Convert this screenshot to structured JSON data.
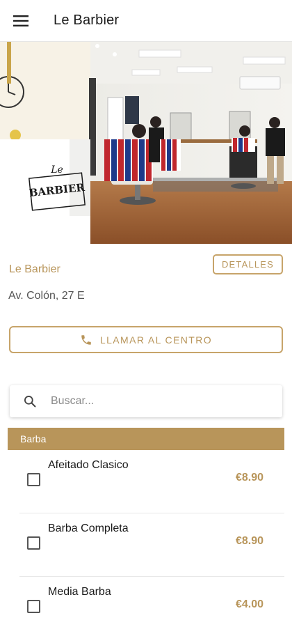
{
  "appbar": {
    "title": "Le Barbier",
    "menu_icon": "hamburger-menu-icon"
  },
  "hero": {
    "sign_top": "Le",
    "sign_main": "BARBIER"
  },
  "shop": {
    "name": "Le Barbier",
    "details_label": "DETALLES",
    "address": "Av. Colón, 27 E",
    "call_label": "LLAMAR AL CENTRO"
  },
  "search": {
    "placeholder": "Buscar...",
    "value": ""
  },
  "category": {
    "title": "Barba",
    "services": [
      {
        "name": "Afeitado Clasico",
        "price": "€8.90",
        "checked": false
      },
      {
        "name": "Barba Completa",
        "price": "€8.90",
        "checked": false
      },
      {
        "name": "Media Barba",
        "price": "€4.00",
        "checked": false
      }
    ]
  },
  "colors": {
    "accent": "#b8955a",
    "border_accent": "#c7a46a"
  }
}
